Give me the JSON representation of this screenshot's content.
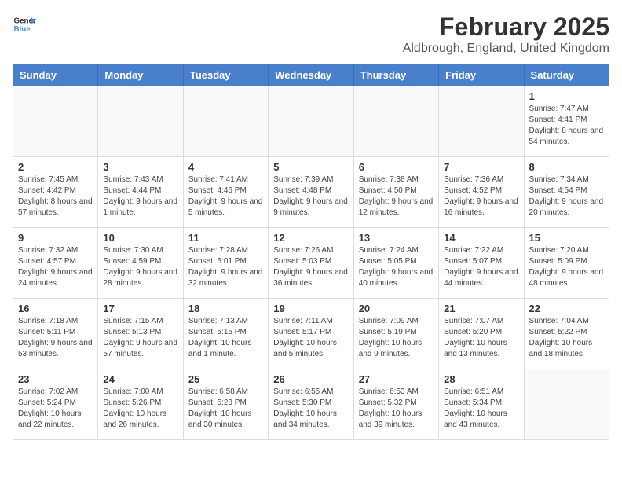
{
  "header": {
    "logo_line1": "General",
    "logo_line2": "Blue",
    "title": "February 2025",
    "subtitle": "Aldbrough, England, United Kingdom"
  },
  "weekdays": [
    "Sunday",
    "Monday",
    "Tuesday",
    "Wednesday",
    "Thursday",
    "Friday",
    "Saturday"
  ],
  "weeks": [
    [
      {
        "day": "",
        "info": ""
      },
      {
        "day": "",
        "info": ""
      },
      {
        "day": "",
        "info": ""
      },
      {
        "day": "",
        "info": ""
      },
      {
        "day": "",
        "info": ""
      },
      {
        "day": "",
        "info": ""
      },
      {
        "day": "1",
        "info": "Sunrise: 7:47 AM\nSunset: 4:41 PM\nDaylight: 8 hours and 54 minutes."
      }
    ],
    [
      {
        "day": "2",
        "info": "Sunrise: 7:45 AM\nSunset: 4:42 PM\nDaylight: 8 hours and 57 minutes."
      },
      {
        "day": "3",
        "info": "Sunrise: 7:43 AM\nSunset: 4:44 PM\nDaylight: 9 hours and 1 minute."
      },
      {
        "day": "4",
        "info": "Sunrise: 7:41 AM\nSunset: 4:46 PM\nDaylight: 9 hours and 5 minutes."
      },
      {
        "day": "5",
        "info": "Sunrise: 7:39 AM\nSunset: 4:48 PM\nDaylight: 9 hours and 9 minutes."
      },
      {
        "day": "6",
        "info": "Sunrise: 7:38 AM\nSunset: 4:50 PM\nDaylight: 9 hours and 12 minutes."
      },
      {
        "day": "7",
        "info": "Sunrise: 7:36 AM\nSunset: 4:52 PM\nDaylight: 9 hours and 16 minutes."
      },
      {
        "day": "8",
        "info": "Sunrise: 7:34 AM\nSunset: 4:54 PM\nDaylight: 9 hours and 20 minutes."
      }
    ],
    [
      {
        "day": "9",
        "info": "Sunrise: 7:32 AM\nSunset: 4:57 PM\nDaylight: 9 hours and 24 minutes."
      },
      {
        "day": "10",
        "info": "Sunrise: 7:30 AM\nSunset: 4:59 PM\nDaylight: 9 hours and 28 minutes."
      },
      {
        "day": "11",
        "info": "Sunrise: 7:28 AM\nSunset: 5:01 PM\nDaylight: 9 hours and 32 minutes."
      },
      {
        "day": "12",
        "info": "Sunrise: 7:26 AM\nSunset: 5:03 PM\nDaylight: 9 hours and 36 minutes."
      },
      {
        "day": "13",
        "info": "Sunrise: 7:24 AM\nSunset: 5:05 PM\nDaylight: 9 hours and 40 minutes."
      },
      {
        "day": "14",
        "info": "Sunrise: 7:22 AM\nSunset: 5:07 PM\nDaylight: 9 hours and 44 minutes."
      },
      {
        "day": "15",
        "info": "Sunrise: 7:20 AM\nSunset: 5:09 PM\nDaylight: 9 hours and 48 minutes."
      }
    ],
    [
      {
        "day": "16",
        "info": "Sunrise: 7:18 AM\nSunset: 5:11 PM\nDaylight: 9 hours and 53 minutes."
      },
      {
        "day": "17",
        "info": "Sunrise: 7:15 AM\nSunset: 5:13 PM\nDaylight: 9 hours and 57 minutes."
      },
      {
        "day": "18",
        "info": "Sunrise: 7:13 AM\nSunset: 5:15 PM\nDaylight: 10 hours and 1 minute."
      },
      {
        "day": "19",
        "info": "Sunrise: 7:11 AM\nSunset: 5:17 PM\nDaylight: 10 hours and 5 minutes."
      },
      {
        "day": "20",
        "info": "Sunrise: 7:09 AM\nSunset: 5:19 PM\nDaylight: 10 hours and 9 minutes."
      },
      {
        "day": "21",
        "info": "Sunrise: 7:07 AM\nSunset: 5:20 PM\nDaylight: 10 hours and 13 minutes."
      },
      {
        "day": "22",
        "info": "Sunrise: 7:04 AM\nSunset: 5:22 PM\nDaylight: 10 hours and 18 minutes."
      }
    ],
    [
      {
        "day": "23",
        "info": "Sunrise: 7:02 AM\nSunset: 5:24 PM\nDaylight: 10 hours and 22 minutes."
      },
      {
        "day": "24",
        "info": "Sunrise: 7:00 AM\nSunset: 5:26 PM\nDaylight: 10 hours and 26 minutes."
      },
      {
        "day": "25",
        "info": "Sunrise: 6:58 AM\nSunset: 5:28 PM\nDaylight: 10 hours and 30 minutes."
      },
      {
        "day": "26",
        "info": "Sunrise: 6:55 AM\nSunset: 5:30 PM\nDaylight: 10 hours and 34 minutes."
      },
      {
        "day": "27",
        "info": "Sunrise: 6:53 AM\nSunset: 5:32 PM\nDaylight: 10 hours and 39 minutes."
      },
      {
        "day": "28",
        "info": "Sunrise: 6:51 AM\nSunset: 5:34 PM\nDaylight: 10 hours and 43 minutes."
      },
      {
        "day": "",
        "info": ""
      }
    ]
  ]
}
